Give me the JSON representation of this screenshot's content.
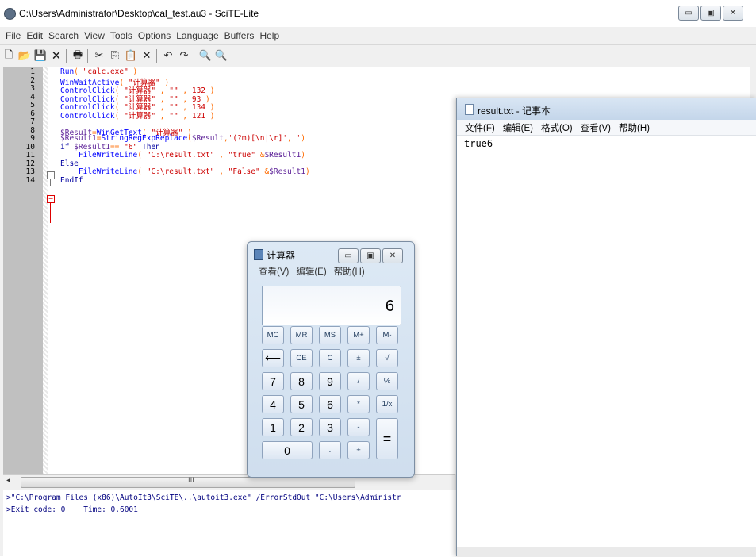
{
  "scite": {
    "title": "C:\\Users\\Administrator\\Desktop\\cal_test.au3 - SciTE-Lite",
    "menu": [
      "File",
      "Edit",
      "Search",
      "View",
      "Tools",
      "Options",
      "Language",
      "Buffers",
      "Help"
    ],
    "toolbar": {
      "new": "🗋",
      "open": "📂",
      "save": "💾",
      "close": "🗙",
      "print": "🖶",
      "cut": "✂",
      "copy": "⎘",
      "paste": "📋",
      "delete": "✕",
      "undo": "↶",
      "redo": "↷",
      "find": "🔍",
      "replace": "🔍"
    },
    "editor": {
      "line_numbers": [
        "1",
        "2",
        "3",
        "4",
        "5",
        "6",
        "7",
        "8",
        "9",
        "10",
        "11",
        "12",
        "13",
        "14"
      ],
      "lines": [
        [
          [
            "fn",
            "Run"
          ],
          [
            "op",
            "( "
          ],
          [
            "str",
            "\"calc.exe\""
          ],
          [
            "op",
            " )"
          ]
        ],
        [
          [
            "fn",
            "WinWaitActive"
          ],
          [
            "op",
            "( "
          ],
          [
            "str",
            "\"计算器\""
          ],
          [
            "op",
            " )"
          ]
        ],
        [
          [
            "fn",
            "ControlClick"
          ],
          [
            "op",
            "( "
          ],
          [
            "str",
            "\"计算器\""
          ],
          [
            "op",
            " , "
          ],
          [
            "str",
            "\"\""
          ],
          [
            "op",
            " , "
          ],
          [
            "str",
            "132"
          ],
          [
            "op",
            " )"
          ]
        ],
        [
          [
            "fn",
            "ControlClick"
          ],
          [
            "op",
            "( "
          ],
          [
            "str",
            "\"计算器\""
          ],
          [
            "op",
            " , "
          ],
          [
            "str",
            "\"\""
          ],
          [
            "op",
            " , "
          ],
          [
            "str",
            "93"
          ],
          [
            "op",
            " )"
          ]
        ],
        [
          [
            "fn",
            "ControlClick"
          ],
          [
            "op",
            "( "
          ],
          [
            "str",
            "\"计算器\""
          ],
          [
            "op",
            " , "
          ],
          [
            "str",
            "\"\""
          ],
          [
            "op",
            " , "
          ],
          [
            "str",
            "134"
          ],
          [
            "op",
            " )"
          ]
        ],
        [
          [
            "fn",
            "ControlClick"
          ],
          [
            "op",
            "( "
          ],
          [
            "str",
            "\"计算器\""
          ],
          [
            "op",
            " , "
          ],
          [
            "str",
            "\"\""
          ],
          [
            "op",
            " , "
          ],
          [
            "str",
            "121"
          ],
          [
            "op",
            " )"
          ]
        ],
        [],
        [
          [
            "var",
            "$Result"
          ],
          [
            "op",
            "="
          ],
          [
            "fn",
            "WinGetText"
          ],
          [
            "op",
            "( "
          ],
          [
            "str",
            "\"计算器\""
          ],
          [
            "op",
            " )"
          ]
        ],
        [
          [
            "var",
            "$Result1"
          ],
          [
            "op",
            "="
          ],
          [
            "fn",
            "StringRegExpReplace"
          ],
          [
            "op",
            "("
          ],
          [
            "var",
            "$Result"
          ],
          [
            "op",
            ","
          ],
          [
            "str",
            "'(?m)[\\n|\\r]'"
          ],
          [
            "op",
            ","
          ],
          [
            "str",
            "''"
          ],
          [
            "op",
            ")"
          ]
        ],
        [
          [
            "kw",
            "if "
          ],
          [
            "var",
            "$Result1"
          ],
          [
            "op",
            "== "
          ],
          [
            "str",
            "\"6\""
          ],
          [
            "kw",
            " Then"
          ]
        ],
        [
          [
            "plain",
            "    "
          ],
          [
            "fn",
            "FileWriteLine"
          ],
          [
            "op",
            "( "
          ],
          [
            "str",
            "\"C:\\result.txt\""
          ],
          [
            "op",
            " , "
          ],
          [
            "str",
            "\"true\""
          ],
          [
            "op",
            " &"
          ],
          [
            "var",
            "$Result1"
          ],
          [
            "op",
            ")"
          ]
        ],
        [
          [
            "kw",
            "Else"
          ]
        ],
        [
          [
            "plain",
            "    "
          ],
          [
            "fn",
            "FileWriteLine"
          ],
          [
            "op",
            "( "
          ],
          [
            "str",
            "\"C:\\result.txt\""
          ],
          [
            "op",
            " , "
          ],
          [
            "str",
            "\"False\""
          ],
          [
            "op",
            " &"
          ],
          [
            "var",
            "$Result1"
          ],
          [
            "op",
            ")"
          ]
        ],
        [
          [
            "kw",
            "EndIf"
          ]
        ]
      ]
    },
    "hscroll_grip": "III",
    "output": [
      ">\"C:\\Program Files (x86)\\AutoIt3\\SciTE\\..\\autoit3.exe\" /ErrorStdOut \"C:\\Users\\Administr",
      ">Exit code: 0    Time: 0.6001"
    ]
  },
  "notepad": {
    "title": "result.txt - 记事本",
    "menu": [
      "文件(F)",
      "编辑(E)",
      "格式(O)",
      "查看(V)",
      "帮助(H)"
    ],
    "content": "true6"
  },
  "calculator": {
    "title": "计算器",
    "menu": [
      "查看(V)",
      "编辑(E)",
      "帮助(H)"
    ],
    "display": "6",
    "buttons": {
      "mc": "MC",
      "mr": "MR",
      "ms": "MS",
      "mplus": "M+",
      "mminus": "M-",
      "back": "⟵",
      "ce": "CE",
      "c": "C",
      "plusminus": "±",
      "sqrt": "√",
      "n7": "7",
      "n8": "8",
      "n9": "9",
      "div": "/",
      "pct": "%",
      "n4": "4",
      "n5": "5",
      "n6": "6",
      "mul": "*",
      "recip": "1/x",
      "n1": "1",
      "n2": "2",
      "n3": "3",
      "sub": "-",
      "eq": "=",
      "n0": "0",
      "dot": ".",
      "add": "+"
    }
  },
  "window_controls": {
    "minimize": "▭",
    "maximize": "▣",
    "close": "✕"
  }
}
